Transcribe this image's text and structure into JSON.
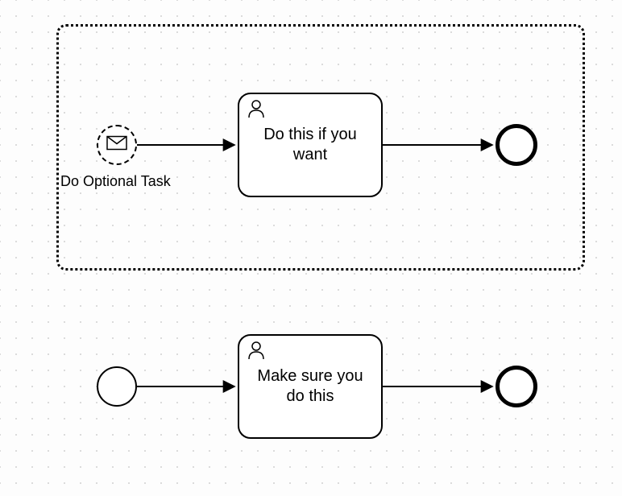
{
  "diagram": {
    "subprocess": {
      "start_event_label": "Do Optional Task",
      "start_event_icon": "envelope-icon",
      "task": {
        "label": "Do this if you want",
        "type_icon": "user-icon"
      },
      "end_event": "end-event"
    },
    "main": {
      "start_event": "start-event",
      "task": {
        "label": "Make sure you do this",
        "type_icon": "user-icon"
      },
      "end_event": "end-event"
    }
  }
}
